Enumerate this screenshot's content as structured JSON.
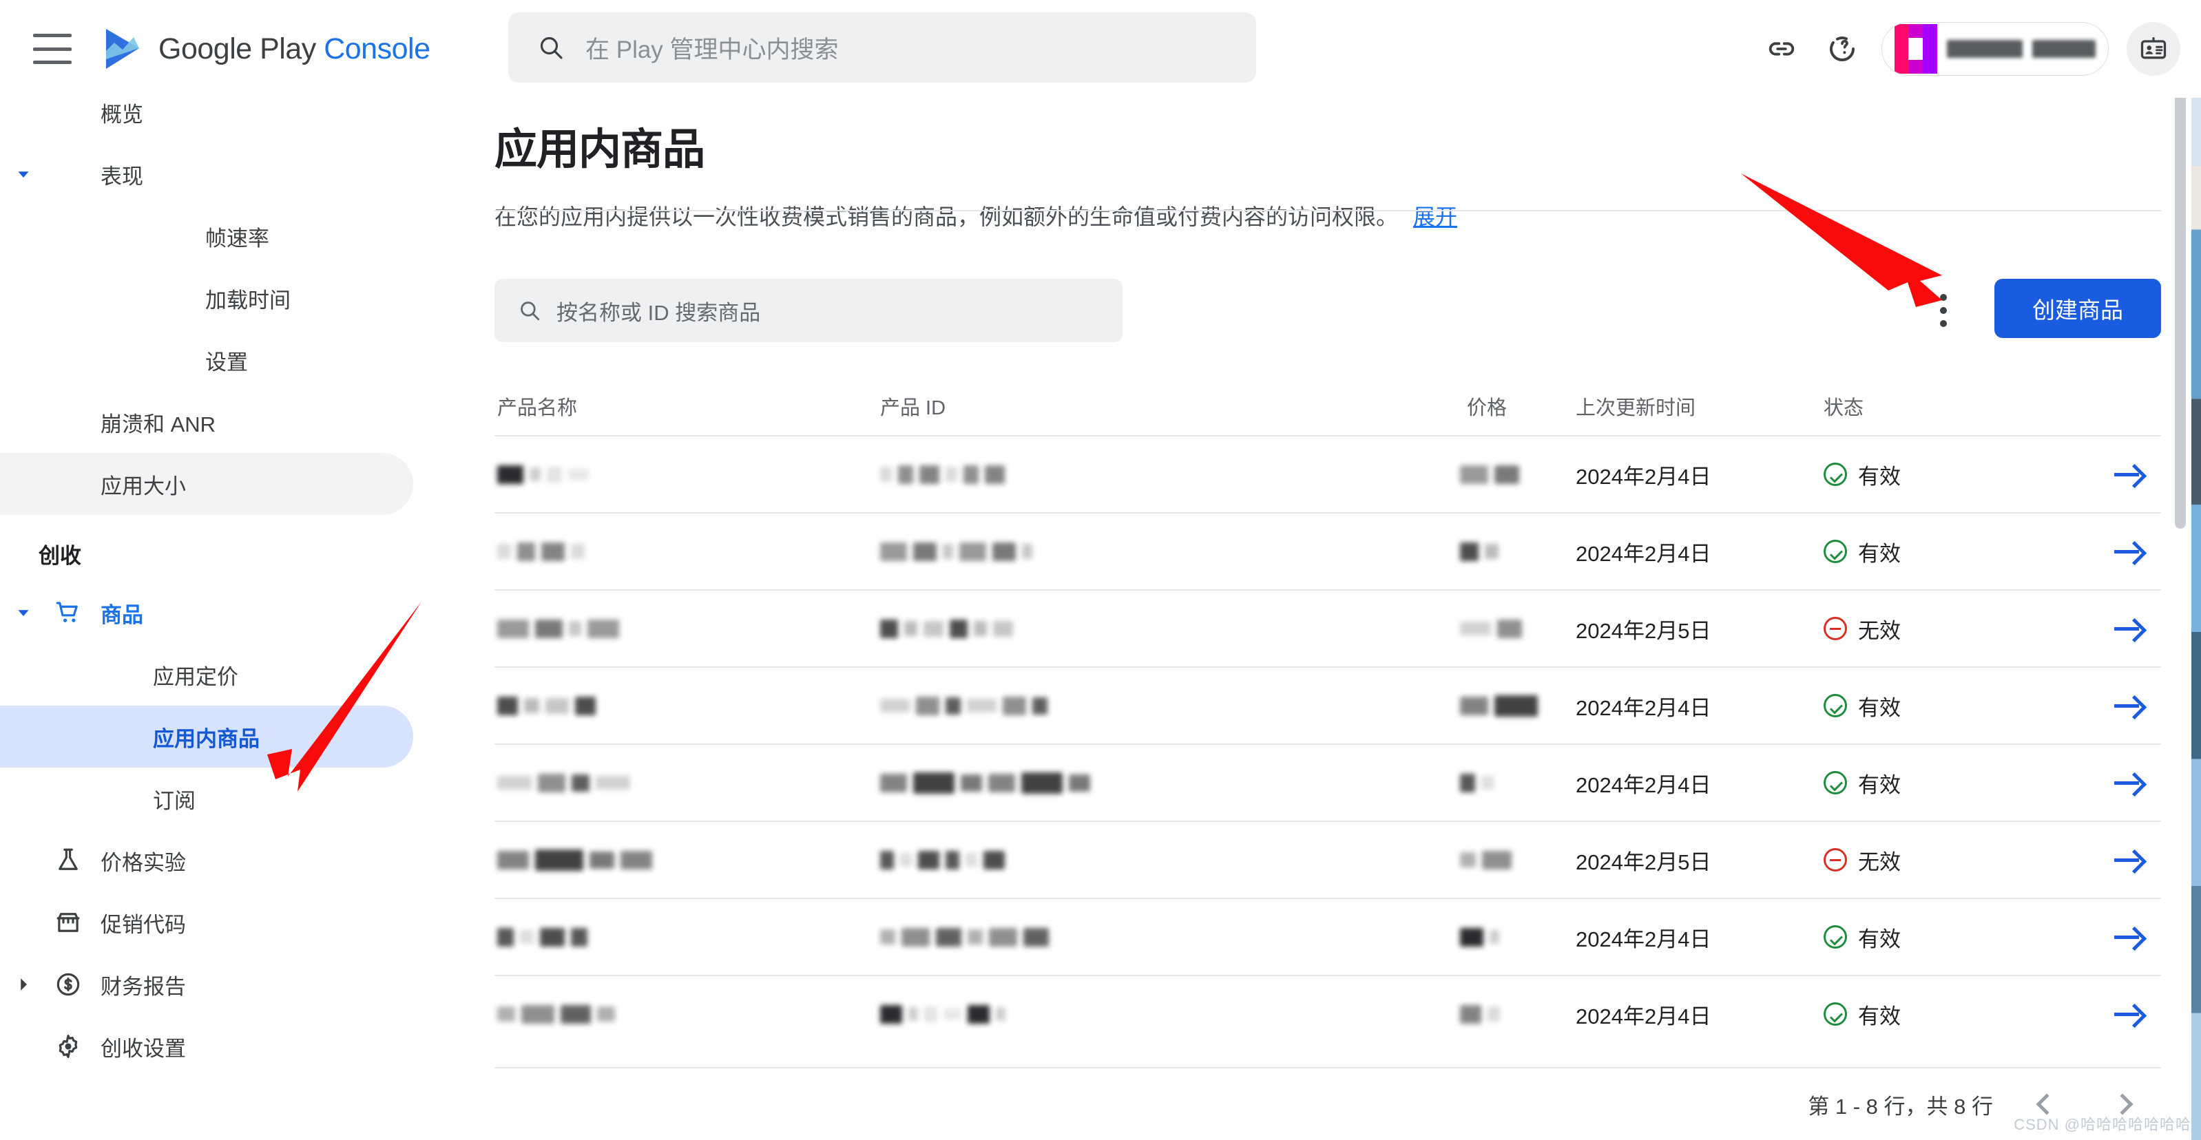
{
  "topbar": {
    "brand_google": "Google Play",
    "brand_console": "Console",
    "search_placeholder": "在 Play 管理中心内搜索",
    "icons": [
      "link-icon",
      "help-history-icon",
      "app-switcher",
      "id-badge-icon"
    ]
  },
  "sidebar": {
    "items": [
      {
        "label": "概览",
        "level": 1,
        "icon": "",
        "caret": "",
        "state": ""
      },
      {
        "label": "表现",
        "level": 1,
        "icon": "",
        "caret": "down",
        "state": ""
      },
      {
        "label": "帧速率",
        "level": 3,
        "icon": "",
        "caret": "",
        "state": ""
      },
      {
        "label": "加载时间",
        "level": 3,
        "icon": "",
        "caret": "",
        "state": ""
      },
      {
        "label": "设置",
        "level": 3,
        "icon": "",
        "caret": "",
        "state": ""
      },
      {
        "label": "崩溃和 ANR",
        "level": 1,
        "icon": "",
        "caret": "",
        "state": ""
      },
      {
        "label": "应用大小",
        "level": 1,
        "icon": "",
        "caret": "",
        "state": "grey"
      }
    ],
    "section_title": "创收",
    "monetize_items": [
      {
        "label": "商品",
        "level": 1,
        "icon": "cart-icon",
        "caret": "down",
        "state": "parent"
      },
      {
        "label": "应用定价",
        "level": 2,
        "icon": "",
        "caret": "",
        "state": ""
      },
      {
        "label": "应用内商品",
        "level": 2,
        "icon": "",
        "caret": "",
        "state": "active"
      },
      {
        "label": "订阅",
        "level": 2,
        "icon": "",
        "caret": "",
        "state": ""
      },
      {
        "label": "价格实验",
        "level": 1,
        "icon": "flask-icon",
        "caret": "",
        "state": ""
      },
      {
        "label": "促销代码",
        "level": 1,
        "icon": "store-icon",
        "caret": "",
        "state": ""
      },
      {
        "label": "财务报告",
        "level": 1,
        "icon": "dollar-circle-icon",
        "caret": "right",
        "state": ""
      },
      {
        "label": "创收设置",
        "level": 1,
        "icon": "gear-icon",
        "caret": "",
        "state": ""
      }
    ]
  },
  "main": {
    "title": "应用内商品",
    "description": "在您的应用内提供以一次性收费模式销售的商品，例如额外的生命值或付费内容的访问权限。",
    "expand_label": "展开",
    "product_search_placeholder": "按名称或 ID 搜索商品",
    "create_button": "创建商品",
    "overflow_menu": "more-options",
    "columns": [
      "产品名称",
      "产品 ID",
      "价格",
      "上次更新时间",
      "状态"
    ],
    "rows": [
      {
        "name": "",
        "id": "",
        "price": "",
        "date": "2024年2月4日",
        "status": "有效",
        "status_kind": "ok"
      },
      {
        "name": "",
        "id": "",
        "price": "",
        "date": "2024年2月4日",
        "status": "有效",
        "status_kind": "ok"
      },
      {
        "name": "",
        "id": "",
        "price": "",
        "date": "2024年2月5日",
        "status": "无效",
        "status_kind": "bad"
      },
      {
        "name": "",
        "id": "",
        "price": "",
        "date": "2024年2月4日",
        "status": "有效",
        "status_kind": "ok"
      },
      {
        "name": "",
        "id": "",
        "price": "",
        "date": "2024年2月4日",
        "status": "有效",
        "status_kind": "ok"
      },
      {
        "name": "",
        "id": "",
        "price": "",
        "date": "2024年2月5日",
        "status": "无效",
        "status_kind": "bad"
      },
      {
        "name": "",
        "id": "",
        "price": "",
        "date": "2024年2月4日",
        "status": "有效",
        "status_kind": "ok"
      },
      {
        "name": "",
        "id": "",
        "price": "",
        "date": "2024年2月4日",
        "status": "有效",
        "status_kind": "ok"
      }
    ],
    "row_count_label": "第 1 - 8 行，共 8 行"
  },
  "watermark": "CSDN @哈哈哈哈哈哈哈",
  "colors": {
    "accent_blue": "#1a73e8",
    "button_blue": "#1a5ce0",
    "active_nav_bg": "#d7e3fc",
    "status_ok_green": "#1e8e3e",
    "status_bad_red": "#d93025",
    "annotation_red": "#fa0a0a"
  }
}
